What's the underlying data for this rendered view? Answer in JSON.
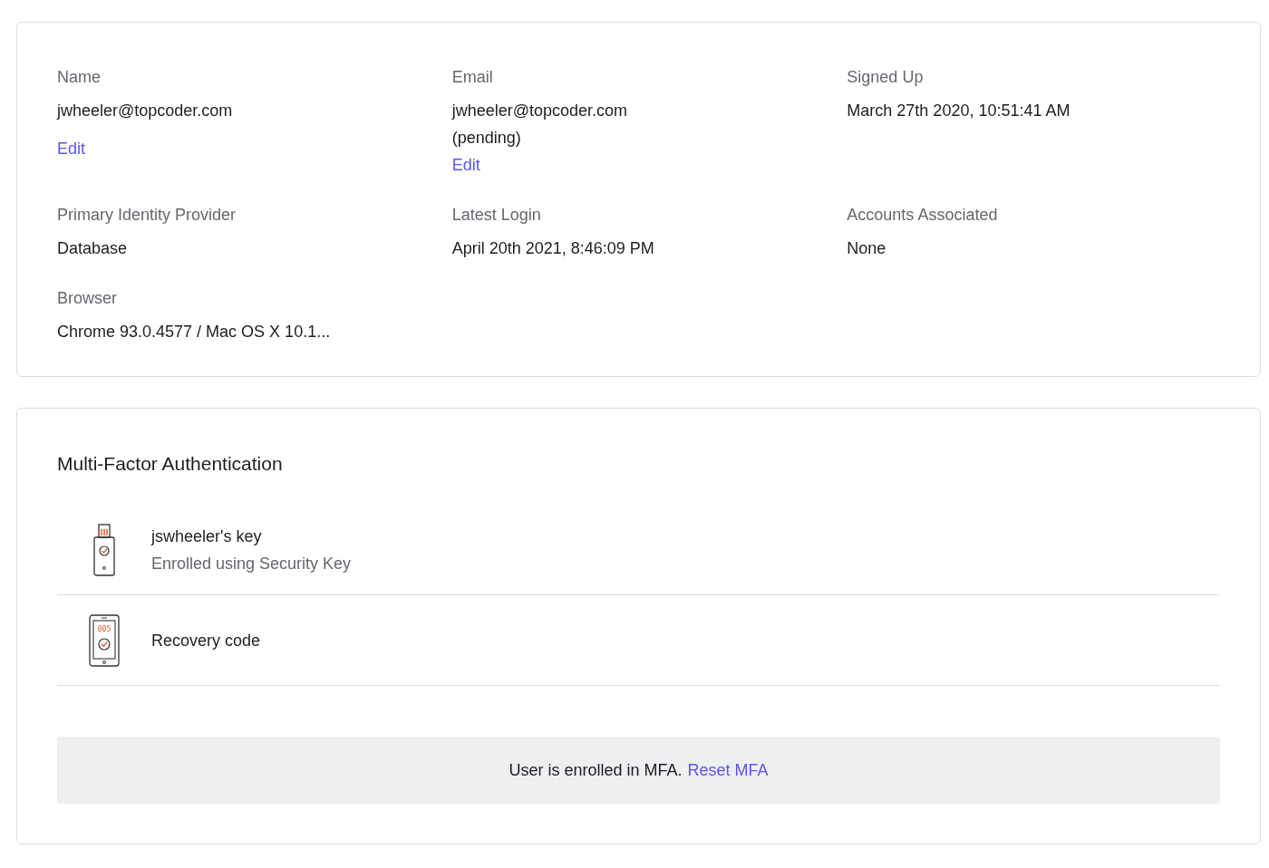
{
  "profile": {
    "fields": [
      {
        "label": "Name",
        "lines": [
          "jwheeler@topcoder.com"
        ],
        "link": "Edit"
      },
      {
        "label": "Email",
        "lines": [
          "jwheeler@topcoder.com",
          "(pending)"
        ],
        "link": "Edit"
      },
      {
        "label": "Signed Up",
        "lines": [
          "March 27th 2020, 10:51:41 AM"
        ]
      },
      {
        "label": "Primary Identity Provider",
        "lines": [
          "Database"
        ]
      },
      {
        "label": "Latest Login",
        "lines": [
          "April 20th 2021, 8:46:09 PM"
        ]
      },
      {
        "label": "Accounts Associated",
        "lines": [
          "None"
        ]
      },
      {
        "label": "Browser",
        "lines": [
          "Chrome 93.0.4577 / Mac OS X 10.1..."
        ]
      }
    ]
  },
  "mfa": {
    "title": "Multi-Factor Authentication",
    "factors": [
      {
        "kind": "security-key",
        "title": "jswheeler's key",
        "subtitle": "Enrolled using Security Key"
      },
      {
        "kind": "recovery-code",
        "title": "Recovery code",
        "code": "005"
      }
    ],
    "status": {
      "text": "User is enrolled in MFA.",
      "link": "Reset MFA"
    }
  }
}
